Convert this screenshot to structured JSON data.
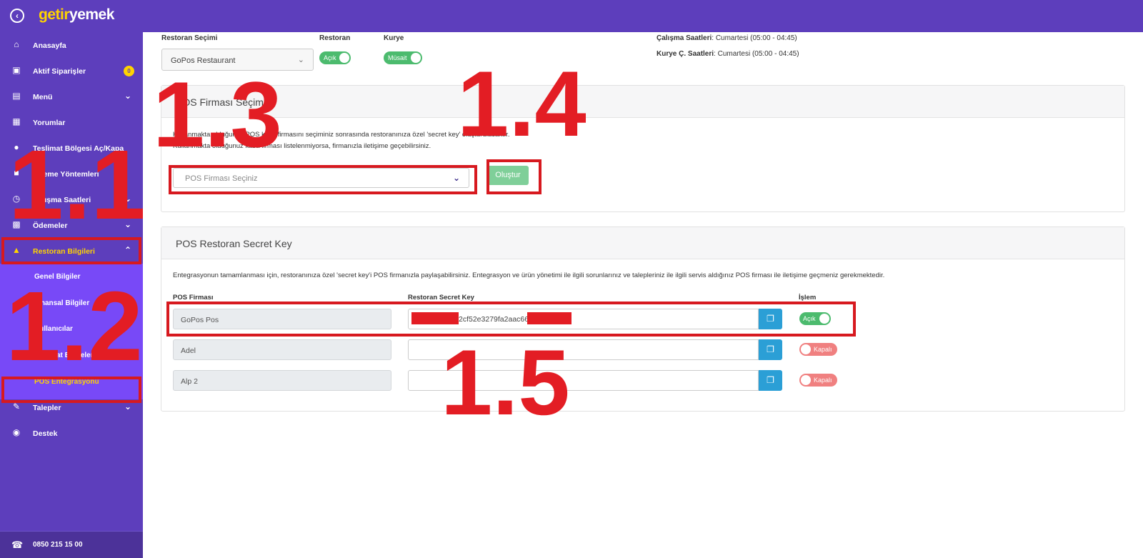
{
  "topbar": {
    "back_icon": "back-arrow-circle-icon",
    "logo_part1": "getir",
    "logo_part2": "yemek"
  },
  "sidebar": {
    "items": [
      {
        "label": "Anasayfa",
        "icon": "home-icon"
      },
      {
        "label": "Aktif Siparişler",
        "icon": "orders-icon",
        "badge": "0"
      },
      {
        "label": "Menü",
        "icon": "menu-icon"
      },
      {
        "label": "Yorumlar",
        "icon": "comments-icon"
      },
      {
        "label": "Teslimat Bölgesi Aç/Kapa",
        "icon": "delivery-zone-icon"
      },
      {
        "label": "Ödeme Yöntemleri",
        "icon": "wallet-icon"
      },
      {
        "label": "Çalışma Saatleri",
        "icon": "clock-icon"
      },
      {
        "label": "Ödemeler",
        "icon": "chart-icon"
      },
      {
        "label": "Restoran Bilgileri",
        "icon": "restaurant-icon"
      },
      {
        "label": "Talepler",
        "icon": "requests-icon"
      },
      {
        "label": "Destek",
        "icon": "support-icon"
      }
    ],
    "submenu": [
      {
        "label": "Genel Bilgiler"
      },
      {
        "label": "Finansal Bilgiler"
      },
      {
        "label": "Kullanıcılar"
      },
      {
        "label": "Teslimat Bölgeleri"
      },
      {
        "label": "POS Entegrasyonu"
      }
    ],
    "footer_phone": "0850 215 15 00"
  },
  "header": {
    "restaurant_select_label": "Restoran Seçimi",
    "restaurant_select_value": "GoPos Restaurant",
    "restaurant_label": "Restoran",
    "restaurant_toggle": "Açık",
    "courier_label": "Kurye",
    "courier_toggle": "Müsait",
    "hours_label": "Çalışma Saatleri",
    "hours_value": ": Cumartesi (05:00 - 04:45)",
    "courier_hours_label": "Kurye Ç. Saatleri",
    "courier_hours_value": ": Cumartesi (05:00 - 04:45)"
  },
  "pos_select_card": {
    "title": "POS Firması Seçimi",
    "desc1": "Kullanmakta olduğunuz POS kasa firmasını seçiminiz sonrasında restoranınıza özel 'secret key' oluşturulacaktır.",
    "desc2": "Kullanmakta olduğunuz kasa firması listelenmiyorsa, firmanızla iletişime geçebilirsiniz.",
    "select_placeholder": "POS Firması Seçiniz",
    "create_button": "Oluştur"
  },
  "secret_card": {
    "title": "POS Restoran Secret Key",
    "desc": "Entegrasyonun tamamlanması için, restoranınıza özel 'secret key'i POS firmanızla paylaşabilirsiniz. Entegrasyon ve ürün yönetimi ile ilgili sorunlarınız ve talepleriniz ile ilgili servis aldığınız POS firması ile iletişime geçmeniz gerekmektedir.",
    "col_firm": "POS Firması",
    "col_key": "Restoran Secret Key",
    "col_action": "İşlem",
    "rows": [
      {
        "firm": "GoPos Pos",
        "key": "2cf52e3279fa2aac66",
        "status": "Açık"
      },
      {
        "firm": "Adel",
        "key": "",
        "status": "Kapalı"
      },
      {
        "firm": "Alp 2",
        "key": "",
        "status": "Kapalı"
      }
    ]
  },
  "annotations": {
    "a11": "1.1",
    "a12": "1.2",
    "a13": "1.3",
    "a14": "1.4",
    "a15": "1.5"
  }
}
